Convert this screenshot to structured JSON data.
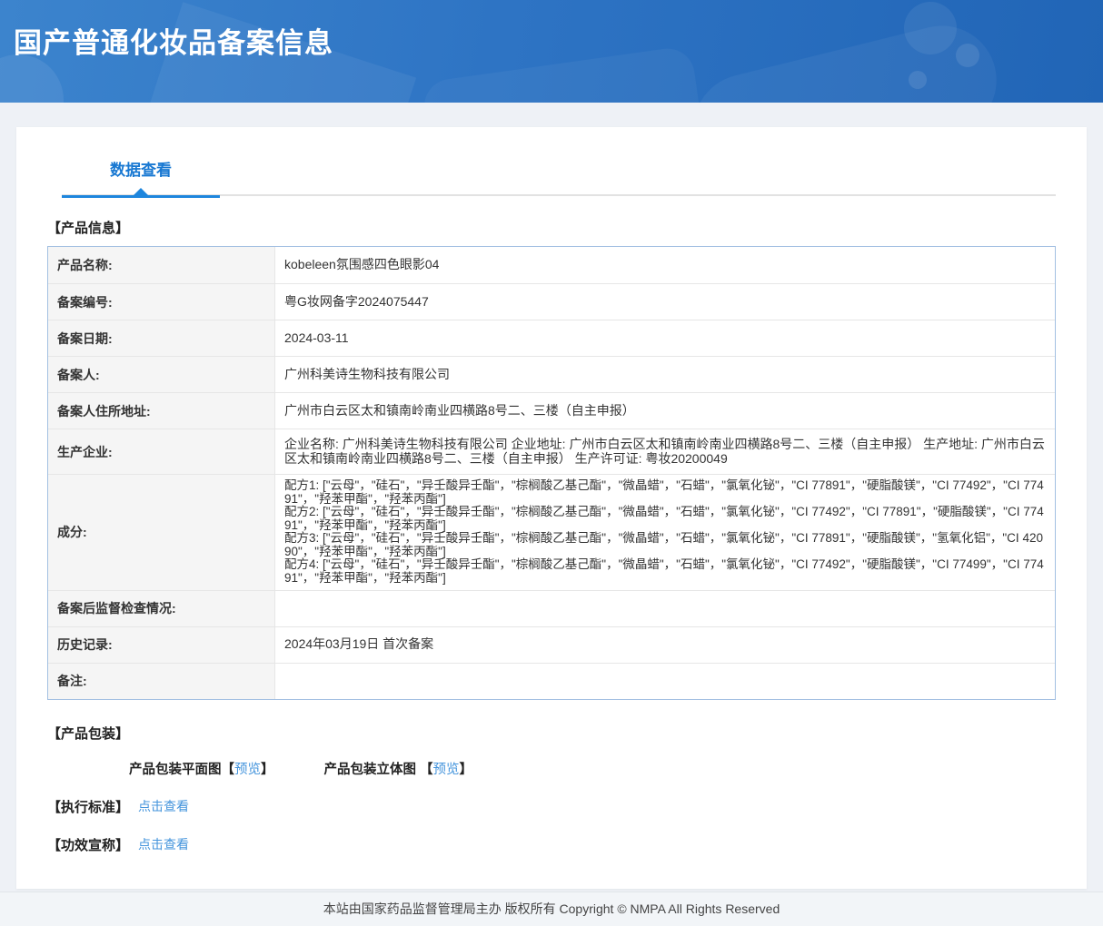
{
  "header": {
    "title": "国产普通化妆品备案信息"
  },
  "tab": {
    "label": "数据查看"
  },
  "section_titles": {
    "product_info": "【产品信息】",
    "packaging": "【产品包装】",
    "standard": "【执行标准】",
    "claims": "【功效宣称】"
  },
  "table": {
    "rows": [
      {
        "label": "产品名称:",
        "value": "kobeleen氛围感四色眼影04"
      },
      {
        "label": "备案编号:",
        "value": "粤G妆网备字2024075447"
      },
      {
        "label": "备案日期:",
        "value": "2024-03-11"
      },
      {
        "label": "备案人:",
        "value": "广州科美诗生物科技有限公司"
      },
      {
        "label": "备案人住所地址:",
        "value": "广州市白云区太和镇南岭南业四横路8号二、三楼（自主申报）"
      },
      {
        "label": "生产企业:",
        "value": "企业名称: 广州科美诗生物科技有限公司 企业地址: 广州市白云区太和镇南岭南业四横路8号二、三楼（自主申报） 生产地址: 广州市白云区太和镇南岭南业四横路8号二、三楼（自主申报） 生产许可证: 粤妆20200049"
      },
      {
        "label": "成分:",
        "value": "配方1: [\"云母\"，\"硅石\"，\"异壬酸异壬酯\"，\"棕榈酸乙基己酯\"，\"微晶蜡\"，\"石蜡\"，\"氯氧化铋\"，\"CI 77891\"，\"硬脂酸镁\"，\"CI 77492\"，\"CI 77491\"，\"羟苯甲酯\"，\"羟苯丙酯\"]\n配方2: [\"云母\"，\"硅石\"，\"异壬酸异壬酯\"，\"棕榈酸乙基己酯\"，\"微晶蜡\"，\"石蜡\"，\"氯氧化铋\"，\"CI 77492\"，\"CI 77891\"，\"硬脂酸镁\"，\"CI 77491\"，\"羟苯甲酯\"，\"羟苯丙酯\"]\n配方3: [\"云母\"，\"硅石\"，\"异壬酸异壬酯\"，\"棕榈酸乙基己酯\"，\"微晶蜡\"，\"石蜡\"，\"氯氧化铋\"，\"CI 77891\"，\"硬脂酸镁\"，\"氢氧化铝\"，\"CI 42090\"，\"羟苯甲酯\"，\"羟苯丙酯\"]\n配方4: [\"云母\"，\"硅石\"，\"异壬酸异壬酯\"，\"棕榈酸乙基己酯\"，\"微晶蜡\"，\"石蜡\"，\"氯氧化铋\"，\"CI 77492\"，\"硬脂酸镁\"，\"CI 77499\"，\"CI 77491\"，\"羟苯甲酯\"，\"羟苯丙酯\"]"
      },
      {
        "label": "备案后监督检查情况:",
        "value": ""
      },
      {
        "label": "历史记录:",
        "value": "2024年03月19日 首次备案"
      },
      {
        "label": "备注:",
        "value": ""
      }
    ]
  },
  "packaging": {
    "items": [
      {
        "label": "产品包装平面图",
        "bracket_open": "【",
        "link": "预览",
        "bracket_close": "】"
      },
      {
        "label": "产品包装立体图 ",
        "bracket_open": "【",
        "link": "预览",
        "bracket_close": "】"
      }
    ]
  },
  "links": {
    "standard_link": "点击查看",
    "claims_link": "点击查看"
  },
  "footer": {
    "text": "本站由国家药品监督管理局主办 版权所有 Copyright © NMPA All Rights Reserved"
  },
  "colors": {
    "accent": "#1878d2",
    "link": "#4494dc",
    "table_border": "#a3c0e2",
    "header_gradient_start": "#3c84cd",
    "header_gradient_end": "#2165b6"
  }
}
